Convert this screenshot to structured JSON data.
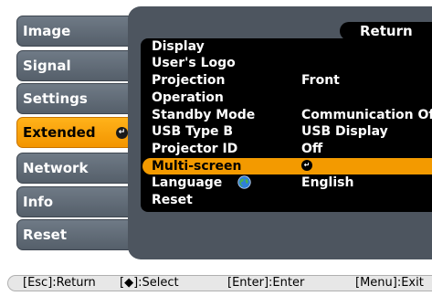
{
  "left_menu": [
    {
      "label": "Image"
    },
    {
      "label": "Signal"
    },
    {
      "label": "Settings"
    },
    {
      "label": "Extended",
      "selected": true
    },
    {
      "label": "Network"
    },
    {
      "label": "Info"
    },
    {
      "label": "Reset"
    }
  ],
  "panel": {
    "return_label": "Return",
    "items": [
      {
        "label": "Display",
        "value": ""
      },
      {
        "label": "User's Logo",
        "value": ""
      },
      {
        "label": "Projection",
        "value": "Front"
      },
      {
        "label": "Operation",
        "value": ""
      },
      {
        "label": "Standby Mode",
        "value": "Communication Off"
      },
      {
        "label": "USB Type B",
        "value": "USB Display"
      },
      {
        "label": "Projector ID",
        "value": "Off"
      },
      {
        "label": "Multi-screen",
        "value": "",
        "selected": true
      },
      {
        "label": "Language",
        "value": "English"
      },
      {
        "label": "Reset",
        "value": ""
      }
    ]
  },
  "help_bar": {
    "esc": "[Esc]:Return",
    "select": "[◆]:Select",
    "enter": "[Enter]:Enter",
    "menu": "[Menu]:Exit"
  },
  "icons": {
    "enter_mark": "enter-icon",
    "language": "globe-icon"
  },
  "colors": {
    "selection": "#f39a00",
    "panel": "#4d555f",
    "menu": "#606a75"
  }
}
